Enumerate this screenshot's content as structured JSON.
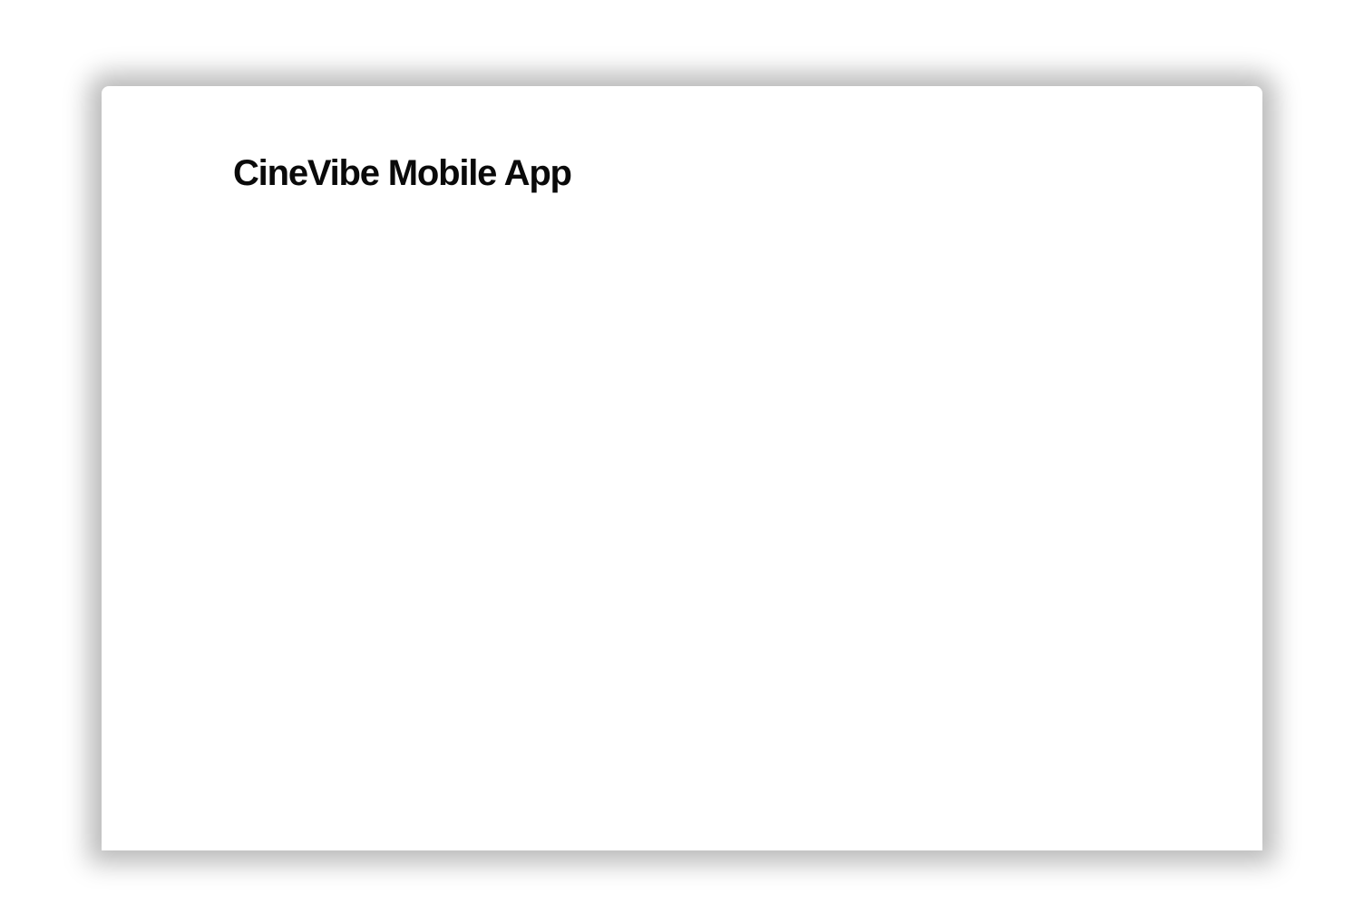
{
  "window": {
    "title": "CineVibe Mobile App",
    "background_color": "#ffffff",
    "title_color": "#0a0a0a"
  }
}
